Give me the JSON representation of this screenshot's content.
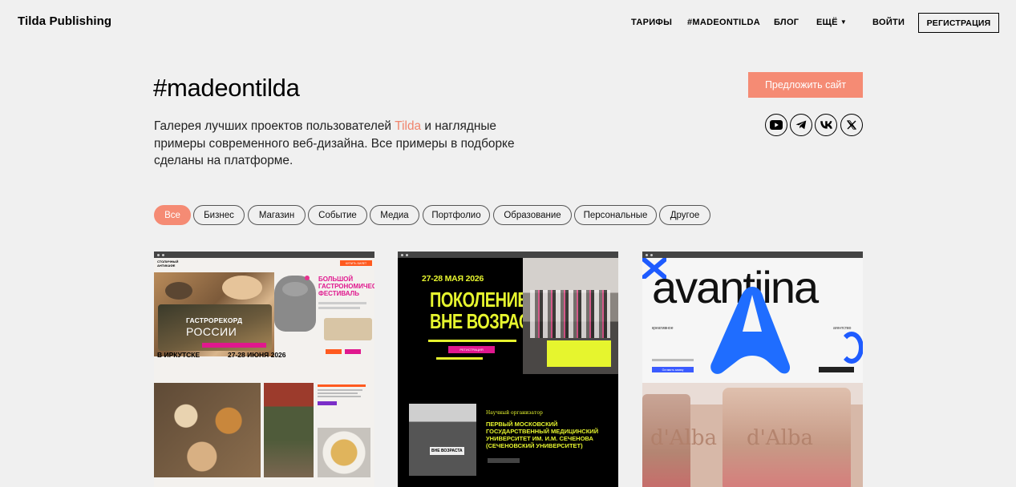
{
  "header": {
    "logo": "Tilda Publishing",
    "nav": [
      "ТАРИФЫ",
      "#MADEONTILDA",
      "БЛОГ",
      "ЕЩЁ"
    ],
    "login": "ВОЙТИ",
    "register": "РЕГИСТРАЦИЯ"
  },
  "hero": {
    "title": "#madeontilda",
    "desc_before": "Галерея лучших проектов пользователей ",
    "desc_accent": "Tilda",
    "desc_after": " и наглядные примеры современного веб-дизайна. Все примеры в подборке сделаны на платформе.",
    "suggest_button": "Предложить сайт",
    "socials": [
      "youtube-icon",
      "telegram-icon",
      "vk-icon",
      "x-icon"
    ]
  },
  "filters": {
    "items": [
      "Все",
      "Бизнес",
      "Магазин",
      "Событие",
      "Медиа",
      "Портфолио",
      "Образование",
      "Персональные",
      "Другое"
    ],
    "active": "Все"
  },
  "cards": {
    "card1": {
      "brand": "СТОЛИЧНЫЙ АНТИКАФЕ",
      "cta": "КУПИТЬ БИЛЕТ",
      "headline_line1": "БОЛЬШОЙ",
      "headline_line2": "ГАСТРОНОМИЧЕСКИЙ",
      "headline_line3": "ФЕСТИВАЛЬ",
      "badge_line1": "ГАСТРОРЕКОРД",
      "badge_line2": "РОССИИ",
      "city": "В ИРКУТСКЕ",
      "dates": "27-28 ИЮНЯ 2026"
    },
    "card2": {
      "dates": "27-28 МАЯ 2026",
      "title_line1": "ПОКОЛЕНИЕ",
      "title_line2": "ВНЕ ВОЗРАСТА",
      "register": "РЕГИСТРАЦИЯ",
      "organizer_label": "Научный организатор",
      "organizer_line1": "ПЕРВЫЙ МОСКОВСКИЙ",
      "organizer_line2": "ГОСУДАРСТВЕННЫЙ МЕДИЦИНСКИЙ",
      "organizer_line3": "УНИВЕРСИТЕТ ИМ. И.М. СЕЧЕНОВА",
      "organizer_line4": "(СЕЧЕНОВСКИЙ УНИВЕРСИТЕТ)",
      "stage_sign": "ВНЕ ВОЗРАСТА"
    },
    "card3": {
      "wordmark": "avantiina",
      "left_tag": "креативное",
      "right_tag": "агентство",
      "cta": "Оставить заявку",
      "bottle_text": "d'Alba"
    }
  }
}
